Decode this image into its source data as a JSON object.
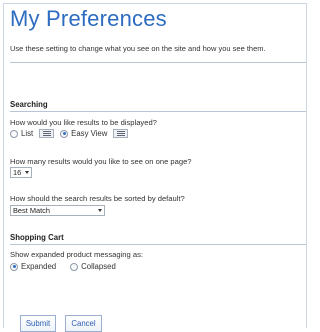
{
  "page": {
    "title": "My Preferences",
    "intro": "Use these setting to change what you see on the site and how you see them."
  },
  "searching": {
    "section_title": "Searching",
    "display_question": "How would you like results to be displayed?",
    "display_options": [
      {
        "label": "List",
        "checked": false,
        "icon": "list-view-icon"
      },
      {
        "label": "Easy View",
        "checked": true,
        "icon": "easy-view-icon"
      }
    ],
    "per_page_question": "How many results would you like to see on one page?",
    "per_page_value": "16",
    "sort_question": "How should the search results be sorted by default?",
    "sort_value": "Best Match"
  },
  "shopping_cart": {
    "section_title": "Shopping Cart",
    "messaging_question": "Show expanded product messaging as:",
    "messaging_options": [
      {
        "label": "Expanded",
        "checked": true
      },
      {
        "label": "Collapsed",
        "checked": false
      }
    ]
  },
  "actions": {
    "submit_label": "Submit",
    "cancel_label": "Cancel"
  },
  "colors": {
    "title": "#2d6cc0",
    "divider": "#b9c4d6",
    "button_text": "#2d5fb0"
  }
}
